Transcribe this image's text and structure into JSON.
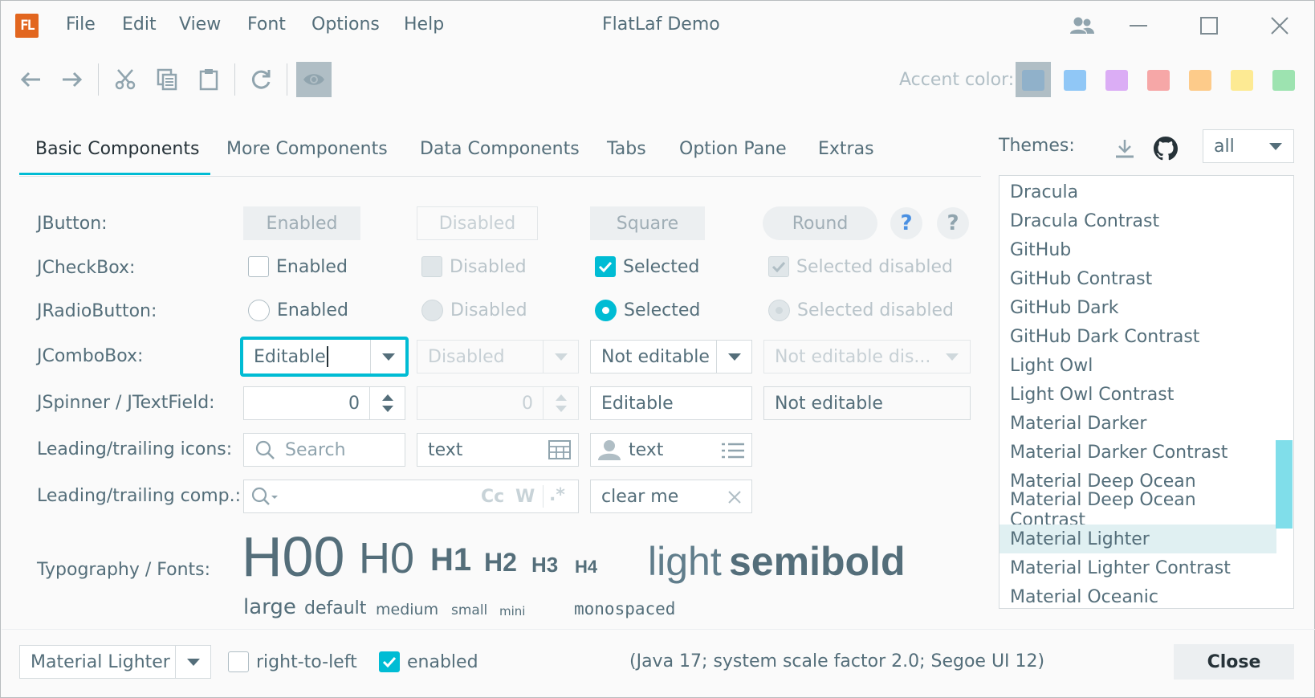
{
  "window": {
    "title": "FlatLaf Demo",
    "logo_text": "FL"
  },
  "menu": [
    "File",
    "Edit",
    "View",
    "Font",
    "Options",
    "Help"
  ],
  "toolbar": {
    "accent_label": "Accent color:",
    "accent_colors": [
      "#7ca8cd",
      "#4aa5f4",
      "#c679f2",
      "#f46f6f",
      "#ffab40",
      "#ffdf4f",
      "#5fd37e"
    ]
  },
  "tabs": [
    "Basic Components",
    "More Components",
    "Data Components",
    "Tabs",
    "Option Pane",
    "Extras"
  ],
  "rows": {
    "button": "JButton:",
    "checkbox": "JCheckBox:",
    "radio": "JRadioButton:",
    "combo": "JComboBox:",
    "spinner": "JSpinner / JTextField:",
    "icons": "Leading/trailing icons:",
    "comps": "Leading/trailing comp.:",
    "typo": "Typography / Fonts:"
  },
  "buttons": {
    "enabled": "Enabled",
    "disabled": "Disabled",
    "square": "Square",
    "round": "Round",
    "help": "?"
  },
  "checkboxes": {
    "enabled": "Enabled",
    "disabled": "Disabled",
    "selected": "Selected",
    "selected_disabled": "Selected disabled"
  },
  "radios": {
    "enabled": "Enabled",
    "disabled": "Disabled",
    "selected": "Selected",
    "selected_disabled": "Selected disabled"
  },
  "combos": {
    "editable": "Editable",
    "disabled": "Disabled",
    "not_editable": "Not editable",
    "not_editable_disabled": "Not editable dis..."
  },
  "spinners": {
    "enabled_value": "0",
    "disabled_value": "0",
    "editable": "Editable",
    "not_editable": "Not editable"
  },
  "icon_fields": {
    "search_placeholder": "Search",
    "text1": "text",
    "text2": "text"
  },
  "comp_fields": {
    "match_case": "Cc",
    "whole_word": "W",
    "regex": ".*",
    "clear_value": "clear me"
  },
  "typography": {
    "h00": "H00",
    "h0": "H0",
    "h1": "H1",
    "h2": "H2",
    "h3": "H3",
    "h4": "H4",
    "light": "light",
    "semibold": "semibold",
    "large": "large",
    "default": "default",
    "medium": "medium",
    "small": "small",
    "mini": "mini",
    "monospaced": "monospaced"
  },
  "themes": {
    "label": "Themes:",
    "filter": "all",
    "items": [
      "Dracula",
      "Dracula Contrast",
      "GitHub",
      "GitHub Contrast",
      "GitHub Dark",
      "GitHub Dark Contrast",
      "Light Owl",
      "Light Owl Contrast",
      "Material Darker",
      "Material Darker Contrast",
      "Material Deep Ocean",
      "Material Deep Ocean Contrast",
      "Material Lighter",
      "Material Lighter Contrast",
      "Material Oceanic"
    ],
    "selected": "Material Lighter"
  },
  "bottom": {
    "theme_combo": "Material Lighter",
    "rtl_label": "right-to-left",
    "enabled_label": "enabled",
    "status": "(Java 17;  system scale factor 2.0; Segoe UI 12)",
    "close_label": "Close"
  }
}
